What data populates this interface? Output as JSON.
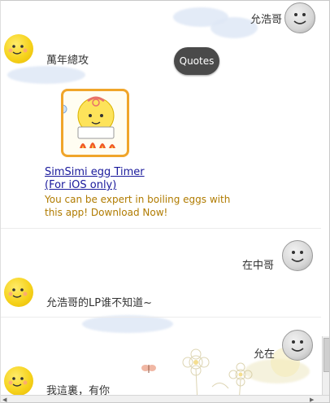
{
  "chat": {
    "messages": [
      {
        "speaker": "user",
        "text": "允浩哥"
      },
      {
        "speaker": "bot",
        "text": "萬年總攻"
      },
      {
        "speaker": "user",
        "text": "在中哥"
      },
      {
        "speaker": "bot",
        "text": "允浩哥的LP谁不知道~"
      },
      {
        "speaker": "user",
        "text": "允在"
      },
      {
        "speaker": "bot",
        "text": "我這裏，有你"
      }
    ]
  },
  "quotes_button": {
    "label": "Quotes"
  },
  "ad": {
    "title_line1": "SimSimi egg Timer",
    "title_line2": "(For iOS only)",
    "description": "You can be expert in boiling eggs with this app! Download Now!"
  },
  "colors": {
    "bot_avatar": "#f6d31d",
    "user_avatar": "#d6d6d6",
    "ad_link": "#1a1a9c",
    "ad_description": "#b07b00",
    "ad_border": "#f0a52a",
    "quotes_button_bg": "#4a4a4a"
  },
  "icons": {
    "bot_avatar": "simsimi-face-icon",
    "user_avatar": "gray-face-icon",
    "ad_image": "egg-timer-app-icon"
  }
}
